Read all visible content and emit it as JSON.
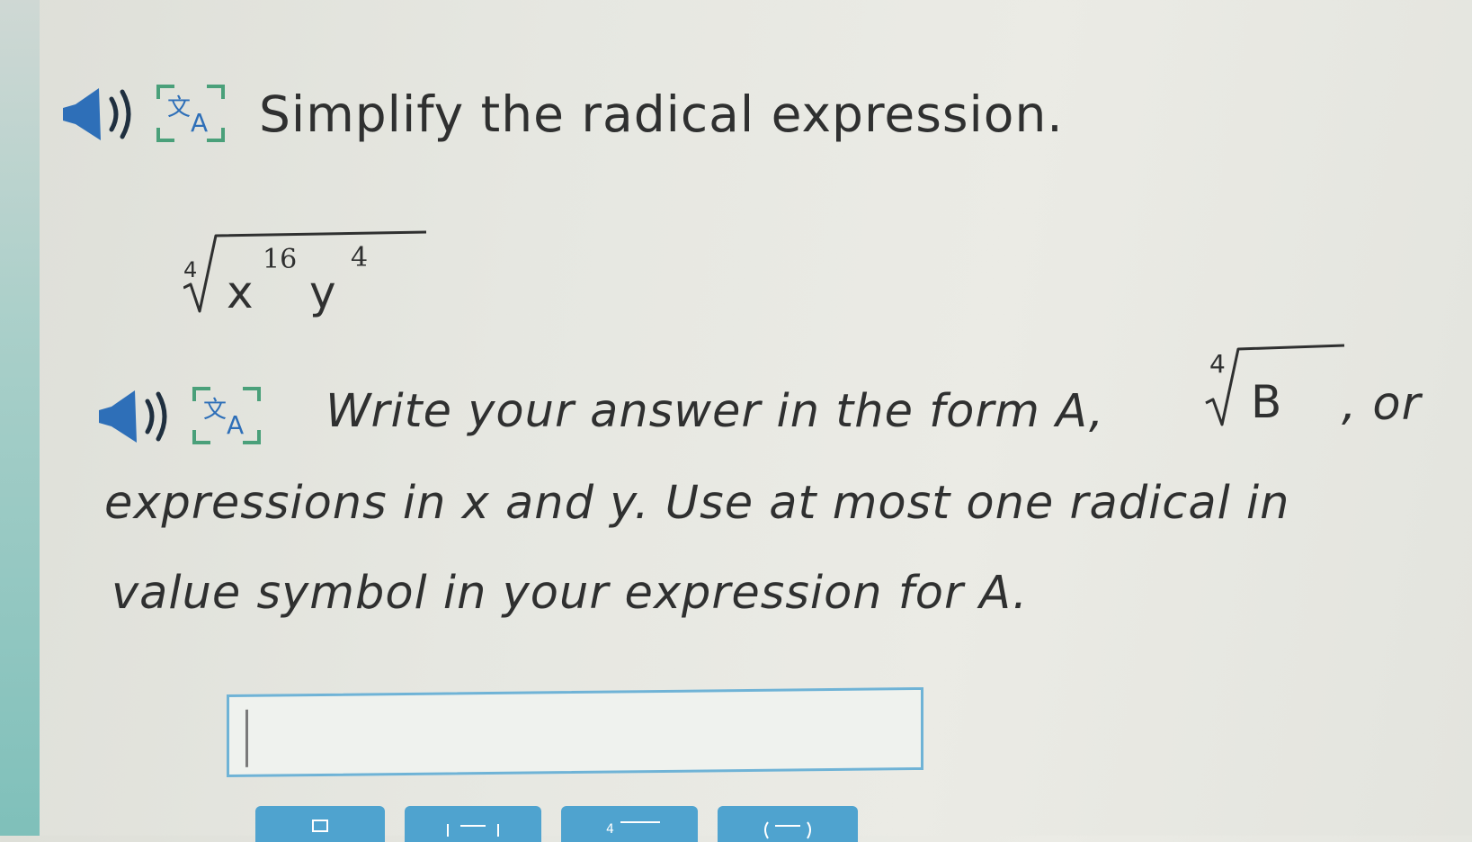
{
  "question": {
    "title": "Simplify the radical expression.",
    "radical": {
      "index": "4",
      "base1": "x",
      "exp1": "16",
      "base2": "y",
      "exp2": "4"
    }
  },
  "instructions": {
    "line1_prefix": "Write your answer in the form A,",
    "form_index": "4",
    "form_radicand": "B",
    "line1_suffix": ", or",
    "line2": "expressions in x and y. Use at most one radical in",
    "line3": "value symbol in your expression for A."
  },
  "answer": {
    "value": ""
  },
  "icons": {
    "speaker": "speaker-icon",
    "translate": "translate-icon"
  },
  "colors": {
    "accent": "#4fa3cf",
    "answer_border": "#6fb3d6",
    "icon_green": "#4aa07a",
    "icon_blue": "#2e6fb8"
  }
}
